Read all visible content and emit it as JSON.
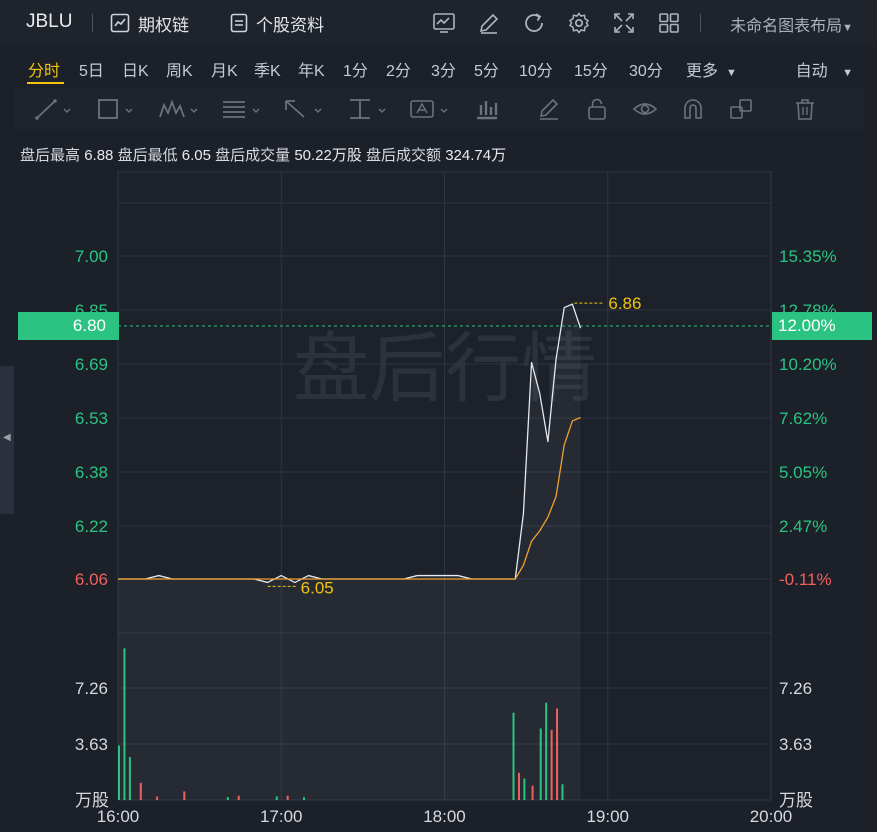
{
  "topbar": {
    "symbol": "JBLU",
    "options_chain": "期权链",
    "stock_profile": "个股资料",
    "layout_name": "未命名图表布局",
    "icons": [
      "indicator-icon",
      "draw-icon",
      "refresh-icon",
      "settings-icon",
      "fullscreen-icon",
      "layout-grid-icon",
      "dropdown-icon"
    ]
  },
  "timeframes": {
    "items": [
      "分时",
      "5日",
      "日K",
      "周K",
      "月K",
      "季K",
      "年K",
      "1分",
      "2分",
      "3分",
      "5分",
      "10分",
      "15分",
      "30分"
    ],
    "active": "分时",
    "more": "更多",
    "auto": "自动"
  },
  "drawing_tools": [
    "line-icon",
    "rect-icon",
    "pattern-icon",
    "fib-icon",
    "arrow-icon",
    "measure-icon",
    "text-icon",
    "position-icon",
    "pen-icon",
    "lock-icon",
    "eye-icon",
    "magnet-icon",
    "layers-icon",
    "trash-icon"
  ],
  "info": {
    "high_label": "盘后最高",
    "high_value": "6.88",
    "low_label": "盘后最低",
    "low_value": "6.05",
    "volume_label": "盘后成交量",
    "volume_value": "50.22万股",
    "turnover_label": "盘后成交额",
    "turnover_value": "324.74万"
  },
  "current": {
    "price": "6.80",
    "pct": "12.00%"
  },
  "watermark": "盘后行情",
  "colors": {
    "up": "#2bc382",
    "down": "#f0605d",
    "accent": "#f1c40f",
    "avg_line": "#f0a030",
    "price_line": "#e6e8ec"
  },
  "chart_data": {
    "type": "line",
    "x_ticks": [
      "16:00",
      "17:00",
      "18:00",
      "19:00",
      "20:00"
    ],
    "xlim": [
      "16:00",
      "20:00"
    ],
    "price_ticks": [
      "7.00",
      "6.85",
      "6.69",
      "6.53",
      "6.38",
      "6.22",
      "6.06"
    ],
    "pct_ticks": [
      "15.35%",
      "12.78%",
      "10.20%",
      "7.62%",
      "5.05%",
      "2.47%",
      "-0.11%"
    ],
    "ylim": [
      6.06,
      7.0
    ],
    "annotations": {
      "high": "6.86",
      "low": "6.05"
    },
    "series": [
      {
        "x": [
          0,
          5,
          10,
          15,
          20,
          25,
          30,
          35,
          40,
          45,
          50,
          55,
          60,
          65,
          70,
          75,
          80,
          85,
          90,
          95,
          100,
          105,
          110,
          115,
          120,
          125,
          130,
          135,
          140,
          143,
          146,
          149,
          152,
          155,
          158,
          161,
          164,
          167,
          170
        ],
        "y": [
          6.06,
          6.06,
          6.06,
          6.07,
          6.06,
          6.06,
          6.06,
          6.06,
          6.06,
          6.06,
          6.06,
          6.05,
          6.07,
          6.05,
          6.07,
          6.06,
          6.06,
          6.06,
          6.06,
          6.06,
          6.06,
          6.06,
          6.07,
          6.07,
          6.07,
          6.07,
          6.06,
          6.06,
          6.06,
          6.06,
          6.06,
          6.25,
          6.69,
          6.6,
          6.46,
          6.7,
          6.85,
          6.86,
          6.79
        ]
      },
      {
        "x": [
          0,
          20,
          40,
          60,
          80,
          100,
          120,
          130,
          138,
          143,
          146,
          149,
          152,
          155,
          158,
          161,
          164,
          167,
          170
        ],
        "y": [
          6.06,
          6.06,
          6.06,
          6.06,
          6.06,
          6.06,
          6.06,
          6.06,
          6.06,
          6.06,
          6.06,
          6.1,
          6.17,
          6.2,
          6.24,
          6.3,
          6.45,
          6.52,
          6.53
        ]
      }
    ],
    "volume": {
      "ticks": [
        "7.26",
        "3.63"
      ],
      "unit": "万股",
      "ylim": [
        0,
        10.9
      ],
      "bars": [
        {
          "x": 0,
          "v": 3.8,
          "c": "up"
        },
        {
          "x": 2,
          "v": 10.6,
          "c": "up"
        },
        {
          "x": 4,
          "v": 3.0,
          "c": "up"
        },
        {
          "x": 8,
          "v": 1.2,
          "c": "down"
        },
        {
          "x": 14,
          "v": 0.25,
          "c": "down"
        },
        {
          "x": 24,
          "v": 0.6,
          "c": "down"
        },
        {
          "x": 40,
          "v": 0.2,
          "c": "up"
        },
        {
          "x": 44,
          "v": 0.3,
          "c": "down"
        },
        {
          "x": 58,
          "v": 0.25,
          "c": "up"
        },
        {
          "x": 62,
          "v": 0.3,
          "c": "down"
        },
        {
          "x": 68,
          "v": 0.2,
          "c": "up"
        },
        {
          "x": 145,
          "v": 6.1,
          "c": "up"
        },
        {
          "x": 147,
          "v": 1.9,
          "c": "down"
        },
        {
          "x": 149,
          "v": 1.5,
          "c": "up"
        },
        {
          "x": 152,
          "v": 1.0,
          "c": "down"
        },
        {
          "x": 155,
          "v": 5.0,
          "c": "up"
        },
        {
          "x": 157,
          "v": 6.8,
          "c": "up"
        },
        {
          "x": 159,
          "v": 4.9,
          "c": "down"
        },
        {
          "x": 161,
          "v": 6.4,
          "c": "down"
        },
        {
          "x": 163,
          "v": 1.1,
          "c": "up"
        }
      ]
    }
  }
}
